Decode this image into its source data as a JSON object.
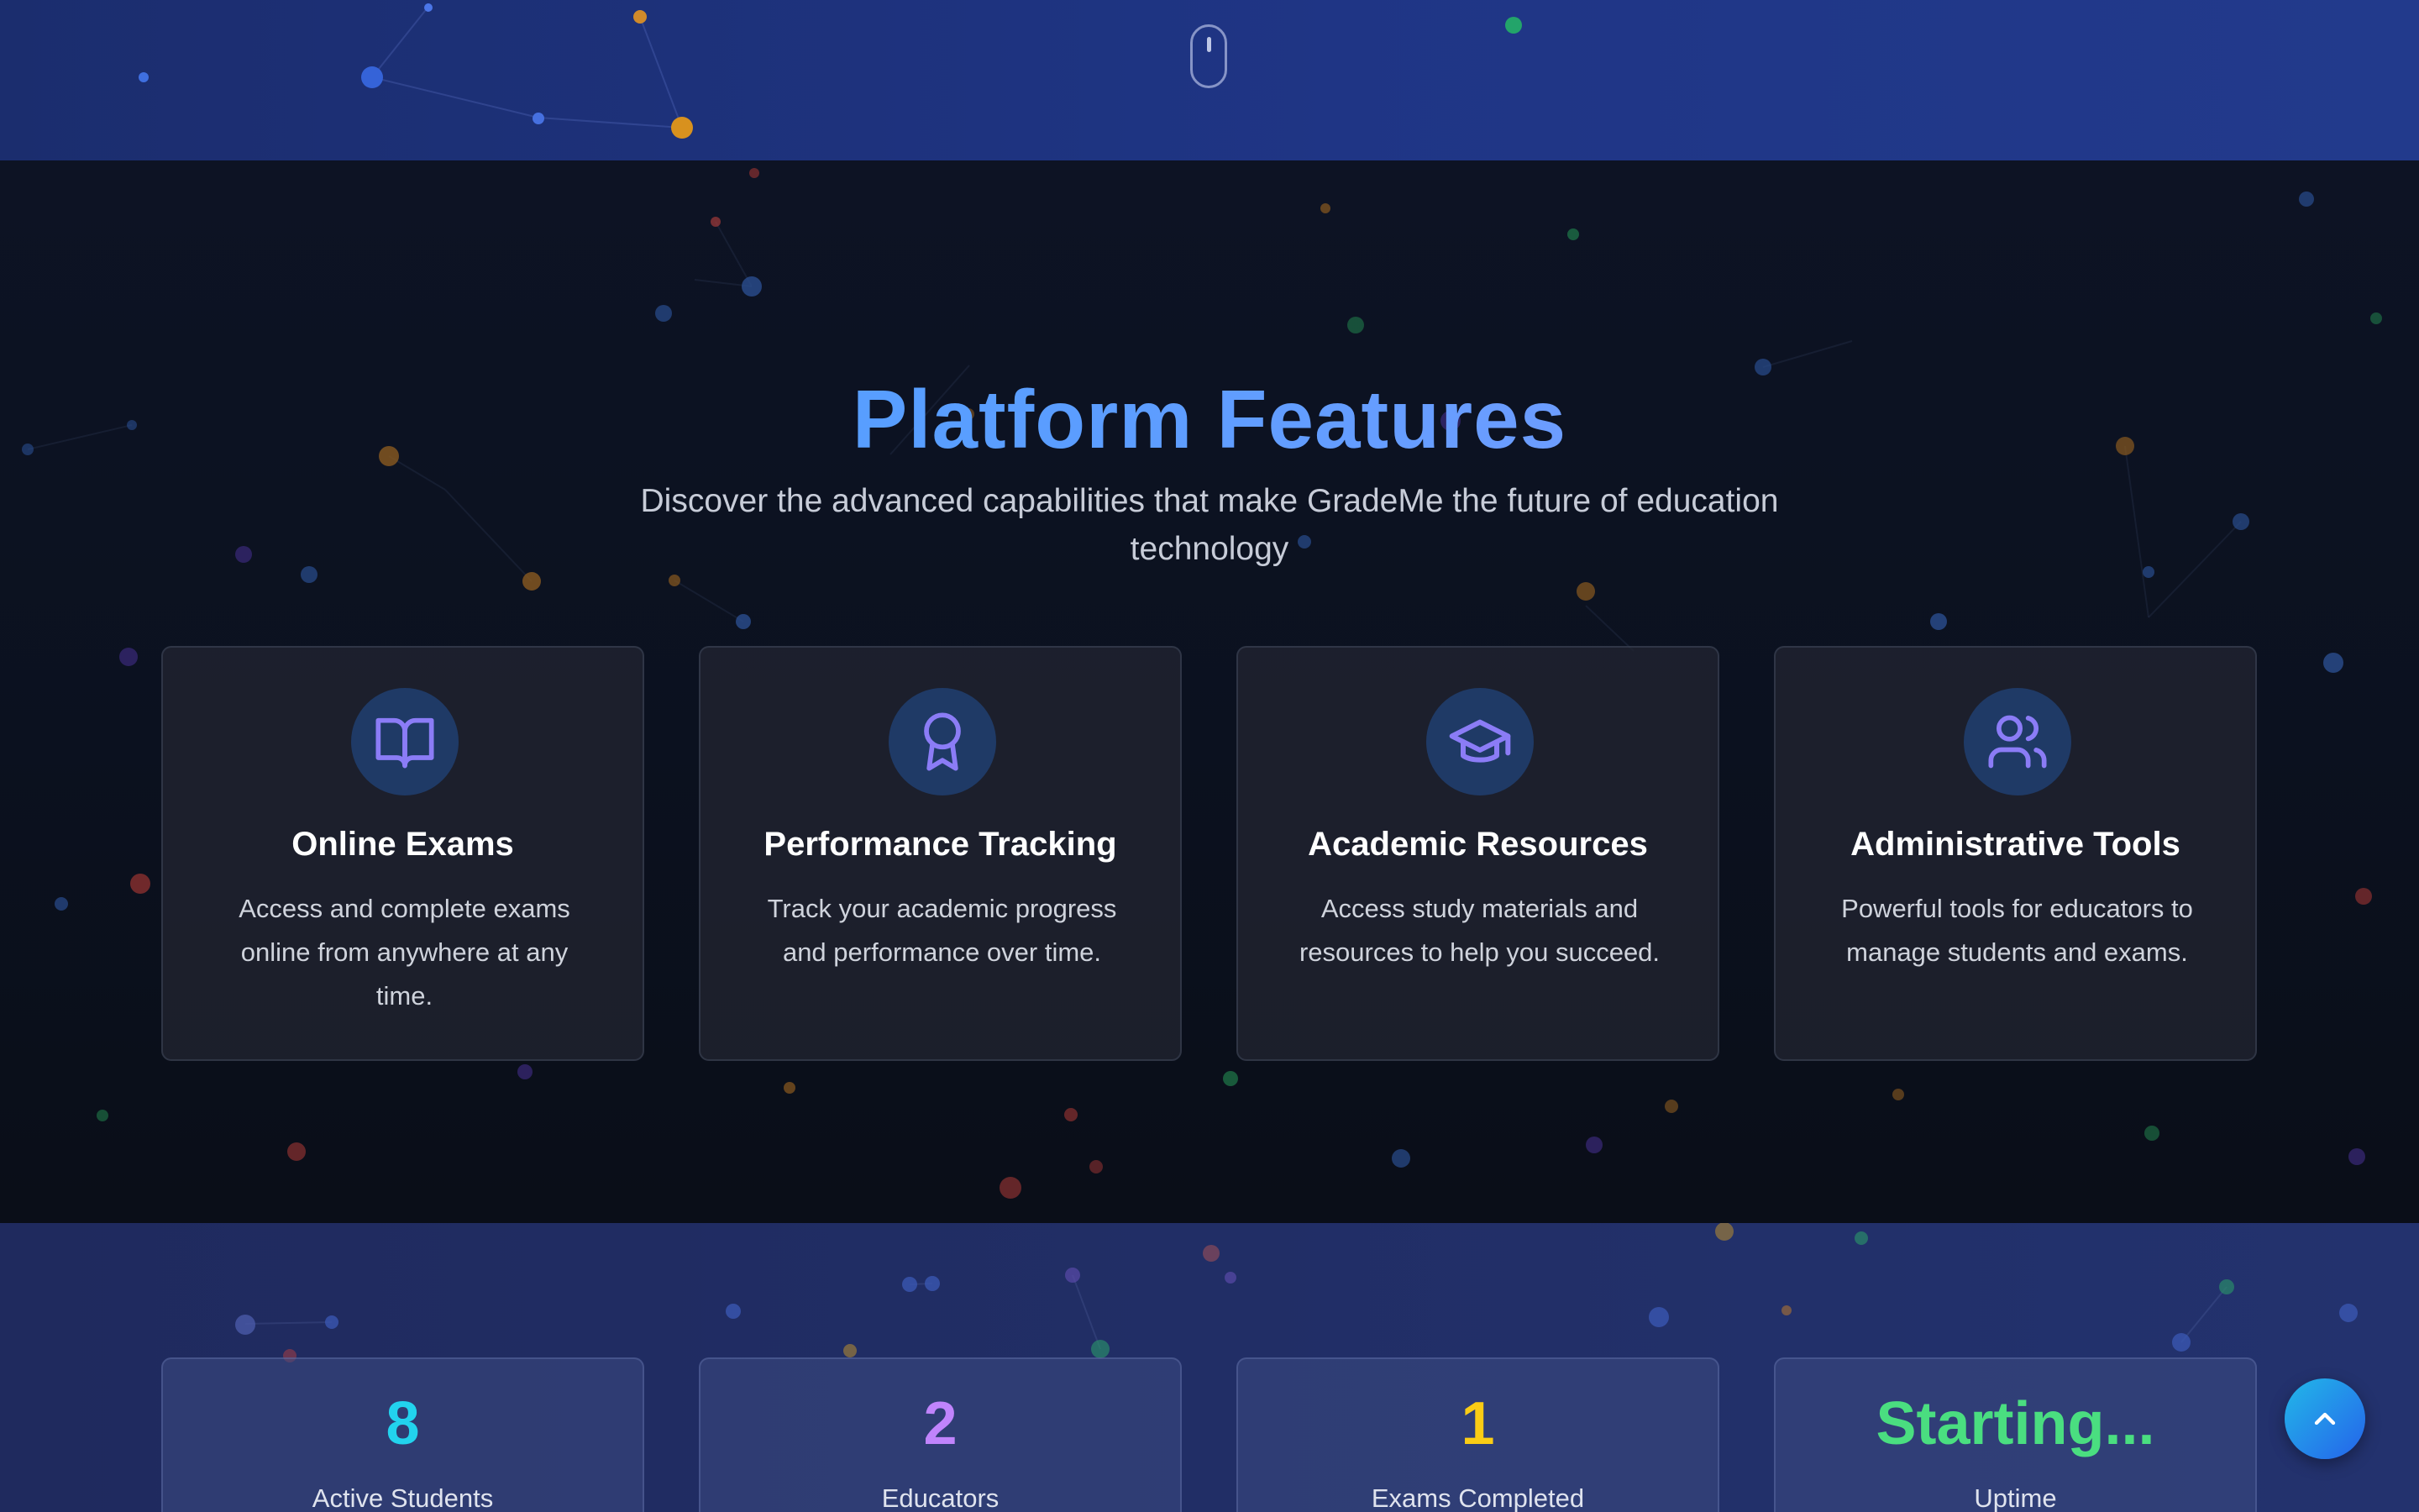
{
  "features": {
    "title": "Platform Features",
    "subtitle": "Discover the advanced capabilities that make GradeMe the future of education technology",
    "cards": [
      {
        "icon": "book-open-icon",
        "title": "Online Exams",
        "description": "Access and complete exams online from anywhere at any time."
      },
      {
        "icon": "award-icon",
        "title": "Performance Tracking",
        "description": "Track your academic progress and performance over time."
      },
      {
        "icon": "graduation-cap-icon",
        "title": "Academic Resources",
        "description": "Access study materials and resources to help you succeed."
      },
      {
        "icon": "users-icon",
        "title": "Administrative Tools",
        "description": "Powerful tools for educators to manage students and exams."
      }
    ]
  },
  "stats": [
    {
      "value": "8",
      "label": "Active Students",
      "color": "#22d3ee"
    },
    {
      "value": "2",
      "label": "Educators",
      "color": "#c084fc"
    },
    {
      "value": "1",
      "label": "Exams Completed",
      "color": "#facc15"
    },
    {
      "value": "Starting...",
      "label": "Uptime",
      "color": "#4ade80"
    }
  ],
  "colors": {
    "accent_icon": "#8b7cf6",
    "scroll_top_button": "#1e90e8"
  }
}
